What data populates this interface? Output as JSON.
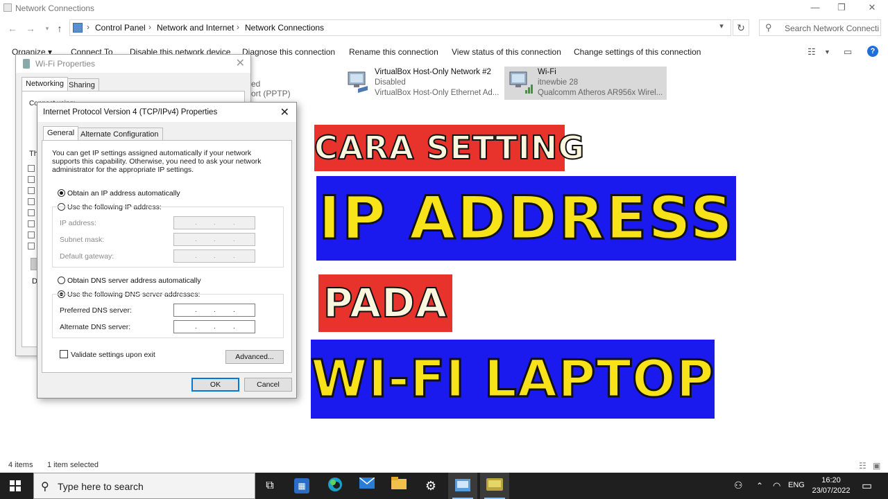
{
  "window": {
    "title": "Network Connections",
    "controls": {
      "minimize": "—",
      "maximize": "❐",
      "close": "✕"
    }
  },
  "address": {
    "breadcrumb": [
      "Control Panel",
      "Network and Internet",
      "Network Connections"
    ],
    "search_placeholder": "Search Network Connecti..."
  },
  "commands": [
    "Organize ▾",
    "Connect To",
    "Disable this network device",
    "Diagnose this connection",
    "Rename this connection",
    "View status of this connection",
    "Change settings of this connection"
  ],
  "adapters": [
    {
      "name": "VirtualBox Host-Only Network #2",
      "status": "Disabled",
      "device": "VirtualBox Host-Only Ethernet Ad..."
    },
    {
      "name": "Wi-Fi",
      "status": "itnewbie 28",
      "device": "Qualcomm Atheros AR956x Wirel..."
    }
  ],
  "background_fragments": {
    "pptp": "ort (PPTP)",
    "ed": "ed"
  },
  "wifi_dialog": {
    "title": "Wi-Fi Properties",
    "tabs": [
      "Networking",
      "Sharing"
    ],
    "fragments": {
      "connect_using": "Connect using:",
      "this_conn": "Th",
      "d": "D"
    }
  },
  "ipv4_dialog": {
    "title": "Internet Protocol Version 4 (TCP/IPv4) Properties",
    "tabs": [
      "General",
      "Alternate Configuration"
    ],
    "description": "You can get IP settings assigned automatically if your network supports this capability. Otherwise, you need to ask your network administrator for the appropriate IP settings.",
    "ip_auto": "Obtain an IP address automatically",
    "ip_manual": "Use the following IP address:",
    "ip_fields": [
      "IP address:",
      "Subnet mask:",
      "Default gateway:"
    ],
    "dns_auto": "Obtain DNS server address automatically",
    "dns_manual": "Use the following DNS server addresses:",
    "dns_fields": [
      "Preferred DNS server:",
      "Alternate DNS server:"
    ],
    "validate": "Validate settings upon exit",
    "advanced": "Advanced...",
    "ok": "OK",
    "cancel": "Cancel",
    "ip_dot": "."
  },
  "banner": {
    "line1": "CARA SETTING",
    "line2": "IP ADDRESS",
    "line3": "PADA",
    "line4": "WI-FI LAPTOP",
    "colors": {
      "red": "#e8332d",
      "blue": "#1a1aee",
      "yellow": "#f8e31a",
      "cream": "#fbf6de"
    }
  },
  "statusbar": {
    "items": "4 items",
    "selected": "1 item selected"
  },
  "taskbar": {
    "search": "Type here to search",
    "lang": "ENG",
    "time": "16:20",
    "date": "23/07/2022"
  }
}
